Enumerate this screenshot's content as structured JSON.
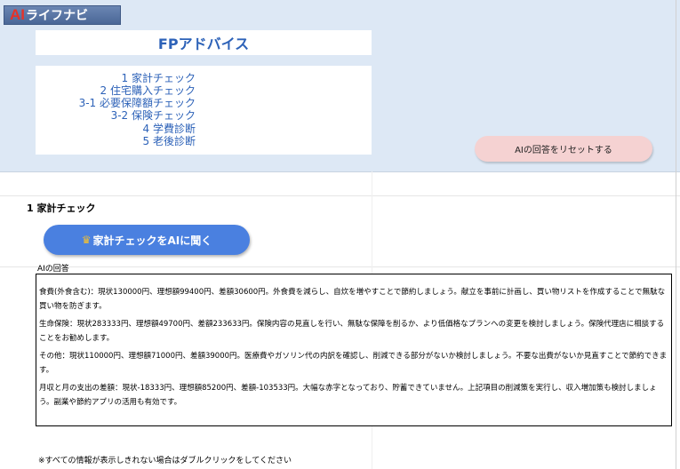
{
  "app": {
    "logo_ai": "AI",
    "logo_rest": "ライフナビ"
  },
  "header": {
    "title": "FPアドバイス"
  },
  "menu": {
    "items": [
      {
        "label": "1 家計チェック"
      },
      {
        "label": "2 住宅購入チェック"
      },
      {
        "label": "3-1 必要保障額チェック"
      },
      {
        "label": "3-2 保険チェック"
      },
      {
        "label": "4 学費診断"
      },
      {
        "label": "5 老後診断"
      }
    ]
  },
  "reset_button": {
    "label": "AIの回答をリセットする"
  },
  "section": {
    "title": "1 家計チェック",
    "ask_button_label": "家計チェックをAIに聞く",
    "ask_button_icon": "crown-icon",
    "answer_label": "AIの回答",
    "answer_paragraphs": [
      "食費(外食含む)：現状130000円、理想額99400円、差額30600円。外食費を減らし、自炊を増やすことで節約しましょう。献立を事前に計画し、買い物リストを作成することで無駄な買い物を防ぎます。",
      "生命保険：現状283333円、理想額49700円、差額233633円。保険内容の見直しを行い、無駄な保障を削るか、より低価格なプランへの変更を検討しましょう。保険代理店に相談することをお勧めします。",
      "その他：現状110000円、理想額71000円、差額39000円。医療費やガソリン代の内訳を確認し、削減できる部分がないか検討しましょう。不要な出費がないか見直すことで節約できます。",
      "月収と月の支出の差額：現状-18333円、理想額85200円、差額-103533円。大幅な赤字となっており、貯蓄できていません。上記項目の削減策を実行し、収入増加策も検討しましょう。副業や節約アプリの活用も有効です。"
    ],
    "footer_note": "※すべての情報が表示しきれない場合はダブルクリックをしてください"
  },
  "colors": {
    "band": "#dde8f5",
    "title_text": "#2d62b8",
    "ask_button": "#4a80e0",
    "reset_button": "#f5d2d2",
    "logo_ai": "#e63228"
  }
}
